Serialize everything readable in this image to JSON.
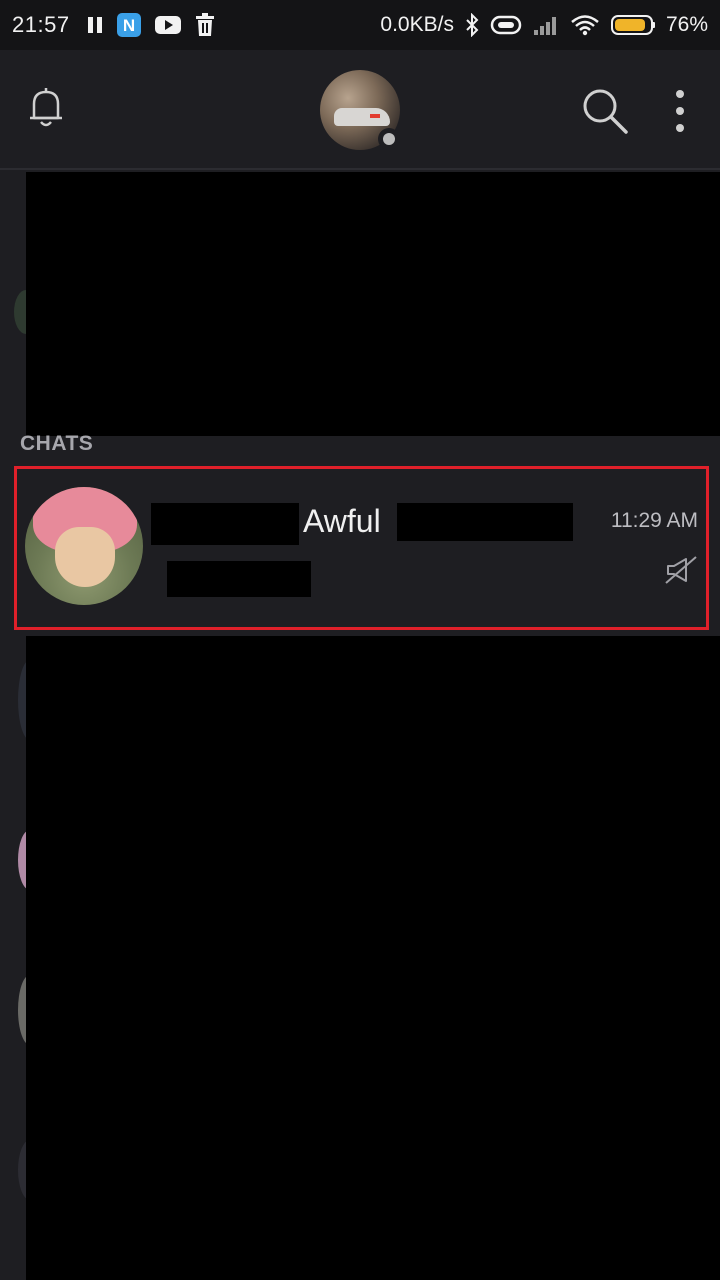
{
  "status_bar": {
    "time": "21:57",
    "speed": "0.0KB/s",
    "battery": "76%",
    "icons": [
      "pause-icon",
      "n-app-icon",
      "youtube-icon",
      "trash-icon",
      "bluetooth-icon",
      "link-icon",
      "signal-icon",
      "wifi-icon",
      "battery-icon"
    ]
  },
  "app_bar": {
    "icons": [
      "bell-icon",
      "profile-avatar",
      "search-icon",
      "more-vert-icon"
    ]
  },
  "section": {
    "title": "CHATS"
  },
  "chat": {
    "name": "Awful",
    "time": "11:29 AM",
    "muted": true
  },
  "colors": {
    "highlight": "#e0202a",
    "background": "#1e1e22"
  }
}
